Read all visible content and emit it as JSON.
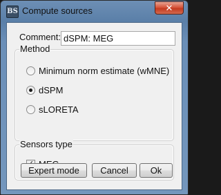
{
  "window": {
    "title": "Compute sources",
    "app_icon_text": "BS",
    "close_glyph": "✕"
  },
  "comment": {
    "label": "Comment:",
    "value": "dSPM: MEG"
  },
  "method": {
    "legend": "Method",
    "selected": "dSPM",
    "options": [
      {
        "label": "Minimum norm estimate (wMNE)",
        "checked": false
      },
      {
        "label": "dSPM",
        "checked": true
      },
      {
        "label": "sLORETA",
        "checked": false
      }
    ]
  },
  "sensors": {
    "legend": "Sensors type",
    "items": [
      {
        "label": "MEG",
        "checked": true,
        "check_glyph": "✓"
      }
    ]
  },
  "buttons": {
    "expert": "Expert mode",
    "cancel": "Cancel",
    "ok": "Ok"
  },
  "colors": {
    "titlebar": "#5a7fa8",
    "close_button": "#c43b20",
    "dialog_bg": "#f0f0f0"
  }
}
